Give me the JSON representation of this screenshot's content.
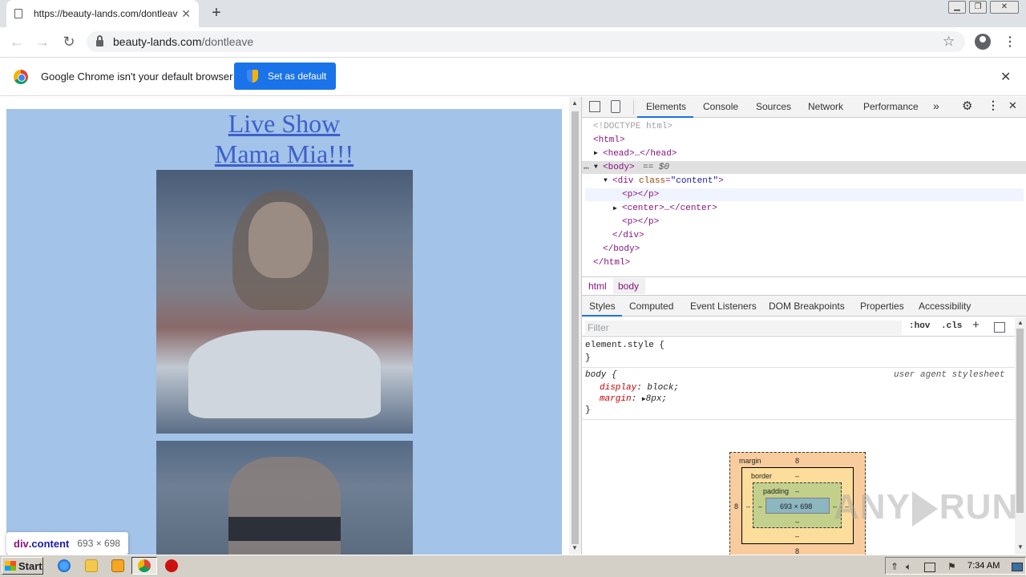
{
  "browser": {
    "tab_title": "https://beauty-lands.com/dontleave",
    "url_host": "beauty-lands.com",
    "url_path": "/dontleave",
    "infobar_text": "Google Chrome isn't your default browser",
    "infobar_button": "Set as default"
  },
  "page": {
    "link1": "Live Show",
    "link2": "Mama Mia!!!",
    "background_color": "#a3c3e8",
    "link_color": "#3e5fcc"
  },
  "tooltip": {
    "tag": "div",
    "cls": ".content",
    "dims": "693 × 698"
  },
  "devtools": {
    "tabs": [
      "Elements",
      "Console",
      "Sources",
      "Network",
      "Performance"
    ],
    "dom": {
      "doctype": "<!DOCTYPE html>",
      "html_open": "<html>",
      "head": "<head>…</head>",
      "body_open": "<body>",
      "body_eq": "== $0",
      "div_tag": "<div ",
      "div_attr": "class",
      "div_val": "\"content\"",
      "p1": "<p></p>",
      "center": "<center>…</center>",
      "p2": "<p></p>",
      "div_close": "</div>",
      "body_close": "</body>",
      "html_close": "</html>"
    },
    "breadcrumbs": [
      "html",
      "body"
    ],
    "styles_tabs": [
      "Styles",
      "Computed",
      "Event Listeners",
      "DOM Breakpoints",
      "Properties",
      "Accessibility"
    ],
    "filter_placeholder": "Filter",
    "hov": ":hov",
    "cls": ".cls",
    "element_style": "element.style {",
    "close_brace": "}",
    "body_selector": "body {",
    "user_agent": "user agent stylesheet",
    "decl1_prop": "display",
    "decl1_val": "block;",
    "decl2_prop": "margin",
    "decl2_val": "8px;",
    "boxmodel": {
      "margin_label": "margin",
      "margin_top": "8",
      "margin_bottom": "8",
      "margin_left": "8",
      "border_label": "border",
      "border_val": "–",
      "padding_label": "padding",
      "padding_val": "–",
      "content_size": "693 × 698"
    }
  },
  "taskbar": {
    "start": "Start",
    "time": "7:34 AM"
  },
  "watermark": {
    "left": "ANY",
    "right": "RUN"
  }
}
